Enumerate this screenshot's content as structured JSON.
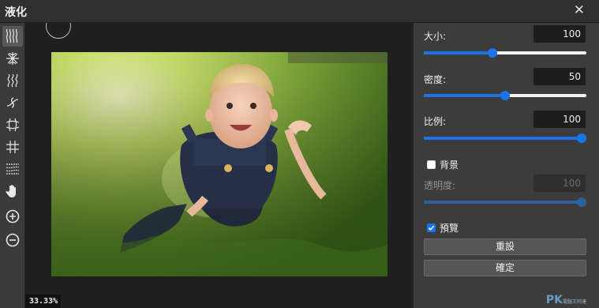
{
  "window": {
    "title": "液化",
    "close_glyph": "✕"
  },
  "tools": [
    {
      "name": "forward-warp-tool-icon",
      "active": true
    },
    {
      "name": "pucker-tool-icon"
    },
    {
      "name": "twirl-clockwise-tool-icon"
    },
    {
      "name": "twirl-tool-icon"
    },
    {
      "name": "bloat-tool-icon"
    },
    {
      "name": "push-left-tool-icon"
    },
    {
      "name": "reconstruct-tool-icon"
    },
    {
      "name": "hand-tool-icon"
    },
    {
      "name": "zoom-in-tool-icon"
    },
    {
      "name": "zoom-out-tool-icon"
    }
  ],
  "canvas": {
    "zoom_label": "33.33%"
  },
  "panel": {
    "size": {
      "label": "大小:",
      "value": "100",
      "fraction": 0.42
    },
    "density": {
      "label": "密度:",
      "value": "50",
      "fraction": 0.5
    },
    "ratio": {
      "label": "比例:",
      "value": "100",
      "fraction": 1.0
    },
    "background": {
      "label": "背景",
      "checked": false
    },
    "opacity": {
      "label": "透明度:",
      "value": "100",
      "fraction": 1.0
    },
    "preview": {
      "label": "預覽",
      "checked": true
    },
    "reset_label": "重設",
    "confirm_label": "確定"
  },
  "colors": {
    "accent": "#1a73e8",
    "panel": "#3c3c3c",
    "titlebar": "#303030"
  },
  "watermark": {
    "text": "PK",
    "sub": "電腦王阿達"
  }
}
